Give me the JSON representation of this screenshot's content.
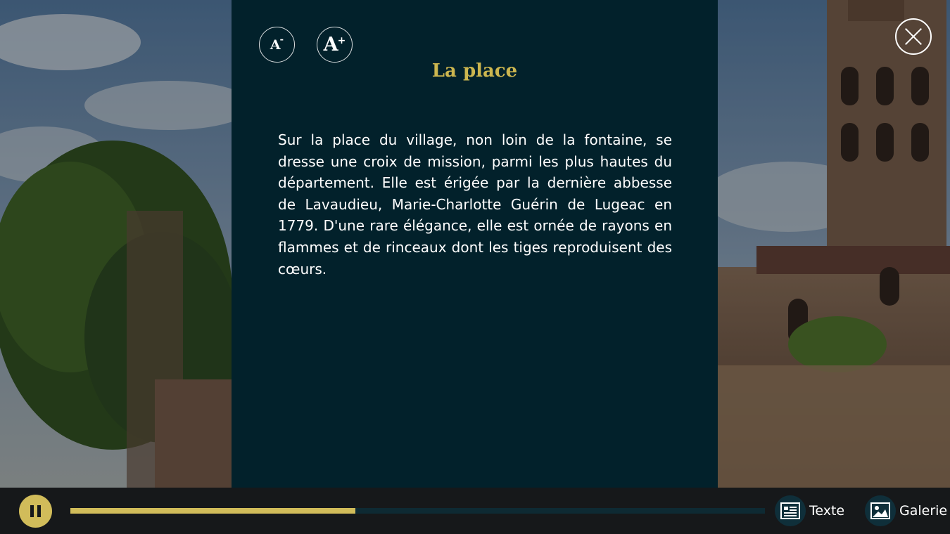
{
  "reader": {
    "title": "La place",
    "body": "Sur la place du village, non loin de la fontaine, se dresse une croix de mission, parmi les plus hautes du département. Elle est érigée par la dernière abbesse de Lavaudieu, Marie-Charlotte Guérin de Lugeac en 1779. D'une rare élégance, elle est ornée de rayons en flammes et de rinceaux dont les tiges reproduisent des cœurs.",
    "font_decrease_glyph": "A",
    "font_decrease_sup": "-",
    "font_increase_glyph": "A",
    "font_increase_sup": "+"
  },
  "player": {
    "state_icon": "pause-icon",
    "progress": 0.41
  },
  "nav": {
    "text_label": "Texte",
    "gallery_label": "Galerie"
  },
  "colors": {
    "accent": "#d1bc5a",
    "panel": "#02212b",
    "title": "#ccb64f",
    "bar": "#16181a"
  }
}
